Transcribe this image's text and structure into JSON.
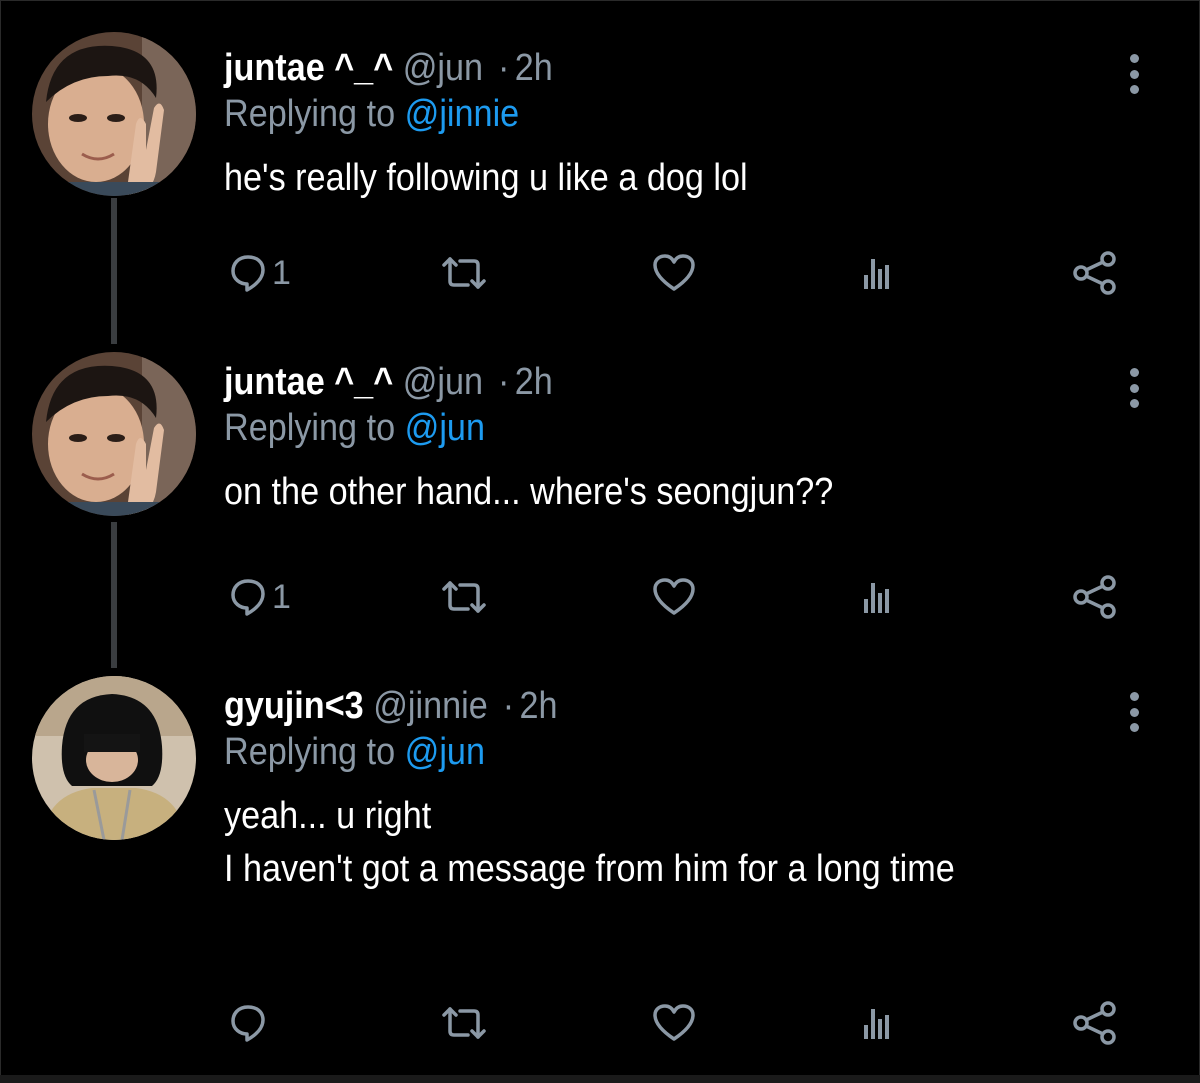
{
  "tweets": [
    {
      "display_name": "juntae ^_^",
      "handle": "@jun",
      "separator": "·",
      "time": "2h",
      "replying_prefix": "Replying to",
      "replying_to": "@jinnie",
      "text": "he's really following u like a dog lol",
      "reply_count": "1",
      "avatar": "juntae-avatar-peace-sign"
    },
    {
      "display_name": "juntae ^_^",
      "handle": "@jun",
      "separator": "·",
      "time": "2h",
      "replying_prefix": "Replying to",
      "replying_to": "@jun",
      "text": "on the other hand... where's seongjun??",
      "reply_count": "1",
      "avatar": "juntae-avatar-peace-sign"
    },
    {
      "display_name": "gyujin<3",
      "handle": "@jinnie",
      "separator": "·",
      "time": "2h",
      "replying_prefix": "Replying to",
      "replying_to": "@jun",
      "text": "yeah... u right\nI haven't got a message from him for a long time",
      "reply_count": "",
      "avatar": "gyujin-avatar-black-hood"
    }
  ],
  "icons": {
    "reply": "reply-icon",
    "retweet": "retweet-icon",
    "like": "heart-icon",
    "analytics": "analytics-icon",
    "share": "share-icon",
    "more": "more-options-icon"
  },
  "colors": {
    "background": "#000000",
    "text": "#ffffff",
    "secondary": "#8b98a5",
    "mention": "#1d9bf0",
    "thread_line": "#3a3d40"
  }
}
